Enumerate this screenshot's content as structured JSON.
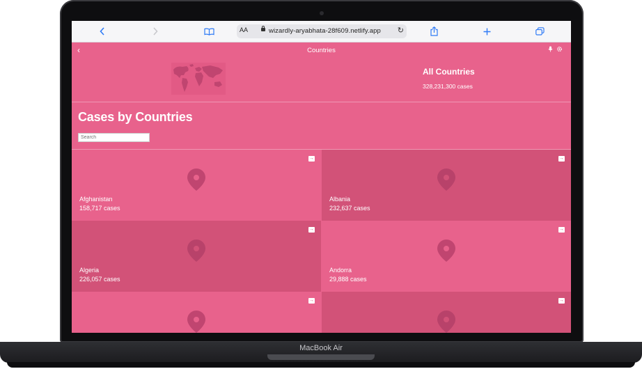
{
  "device": {
    "label": "MacBook Air"
  },
  "browser": {
    "text_size_label": "AA",
    "url": "wizardly-aryabhata-28f609.netlify.app",
    "icons": [
      "chevron-left-icon",
      "chevron-right-icon",
      "book-icon",
      "lock-icon",
      "reload-icon",
      "share-icon",
      "plus-icon",
      "tabs-icon"
    ]
  },
  "header": {
    "title": "Countries"
  },
  "hero": {
    "title": "All Countries",
    "cases": "328,231,300 cases"
  },
  "section": {
    "title": "Cases by Countries"
  },
  "search": {
    "placeholder": "Search"
  },
  "countries": [
    {
      "name": "Afghanistan",
      "cases": "158,717 cases"
    },
    {
      "name": "Albania",
      "cases": "232,637 cases"
    },
    {
      "name": "Algeria",
      "cases": "226,057 cases"
    },
    {
      "name": "Andorra",
      "cases": "29,888 cases"
    },
    {
      "name": "",
      "cases": ""
    },
    {
      "name": "",
      "cases": ""
    }
  ],
  "colors": {
    "primary": "#e8628c",
    "card_dark": "#d25278",
    "pin": "#c04570"
  }
}
